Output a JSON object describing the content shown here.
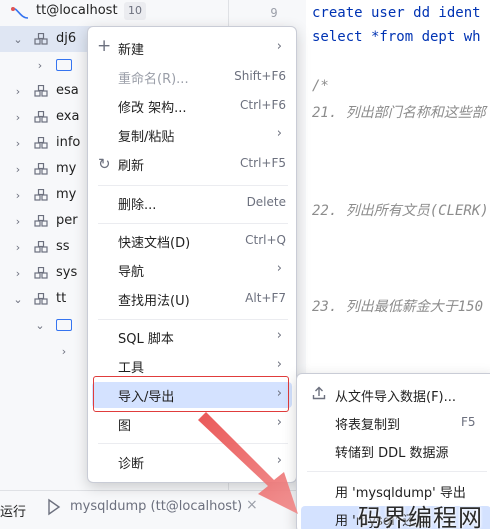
{
  "tree": {
    "host": {
      "label": "tt@localhost",
      "count": "10"
    },
    "items": [
      {
        "label": "dj6"
      },
      {
        "label": "esa"
      },
      {
        "label": "exa"
      },
      {
        "label": "info"
      },
      {
        "label": "my"
      },
      {
        "label": "my"
      },
      {
        "label": "per"
      },
      {
        "label": "ss"
      },
      {
        "label": "sys"
      },
      {
        "label": "tt"
      }
    ]
  },
  "editor": {
    "line_numbers": [
      "9"
    ],
    "lines": [
      {
        "kw": "create user dd ident"
      },
      {
        "kw": "select *from dept wh"
      },
      {
        "comment": "/*"
      },
      {
        "comment": "21. 列出部门名称和这些部"
      },
      {
        "comment": "22. 列出所有文员(CLERK)"
      },
      {
        "comment": "23. 列出最低薪金大于150"
      }
    ]
  },
  "context_menu": {
    "items": [
      {
        "label": "新建",
        "shortcut": "",
        "submenu": true,
        "icon": "+",
        "disabled": false
      },
      {
        "label": "重命名(R)...",
        "shortcut": "Shift+F6",
        "submenu": false,
        "icon": "",
        "disabled": true
      },
      {
        "label": "修改 架构...",
        "shortcut": "Ctrl+F6",
        "submenu": false,
        "icon": "",
        "disabled": false
      },
      {
        "label": "复制/粘贴",
        "shortcut": "",
        "submenu": true,
        "icon": "",
        "disabled": false
      },
      {
        "label": "刷新",
        "shortcut": "Ctrl+F5",
        "submenu": false,
        "icon": "↻",
        "disabled": false
      },
      {
        "label": "删除...",
        "shortcut": "Delete",
        "submenu": false,
        "icon": "",
        "disabled": false
      },
      {
        "label": "快速文档(D)",
        "shortcut": "Ctrl+Q",
        "submenu": false,
        "icon": "",
        "disabled": false
      },
      {
        "label": "导航",
        "shortcut": "",
        "submenu": true,
        "icon": "",
        "disabled": false
      },
      {
        "label": "查找用法(U)",
        "shortcut": "Alt+F7",
        "submenu": false,
        "icon": "",
        "disabled": false
      },
      {
        "label": "SQL 脚本",
        "shortcut": "",
        "submenu": true,
        "icon": "",
        "disabled": false
      },
      {
        "label": "工具",
        "shortcut": "",
        "submenu": true,
        "icon": "",
        "disabled": false
      },
      {
        "label": "导入/导出",
        "shortcut": "",
        "submenu": true,
        "icon": "",
        "disabled": false
      },
      {
        "label": "图",
        "shortcut": "",
        "submenu": true,
        "icon": "",
        "disabled": false
      },
      {
        "label": "诊断",
        "shortcut": "",
        "submenu": true,
        "icon": "",
        "disabled": false
      }
    ],
    "arrow_glyph": "›"
  },
  "submenu": {
    "items": [
      {
        "label": "从文件导入数据(F)...",
        "shortcut": ""
      },
      {
        "label": "将表复制到",
        "shortcut": "F5"
      },
      {
        "label": "转储到 DDL 数据源",
        "shortcut": ""
      },
      {
        "label": "用 'mysqldump' 导出",
        "shortcut": ""
      },
      {
        "label": "用 'mysql' 还原",
        "shortcut": ""
      }
    ]
  },
  "bottombar": {
    "run_label": "运行",
    "task": "mysqldump (tt@localhost)",
    "close": "×"
  },
  "watermark": "码界编程网",
  "colors": {
    "accent": "#3574f0",
    "selection": "#d4e2ff",
    "annotation_red": "#e03c3c",
    "keyword": "#0033b3",
    "comment": "#8c8c8c"
  }
}
